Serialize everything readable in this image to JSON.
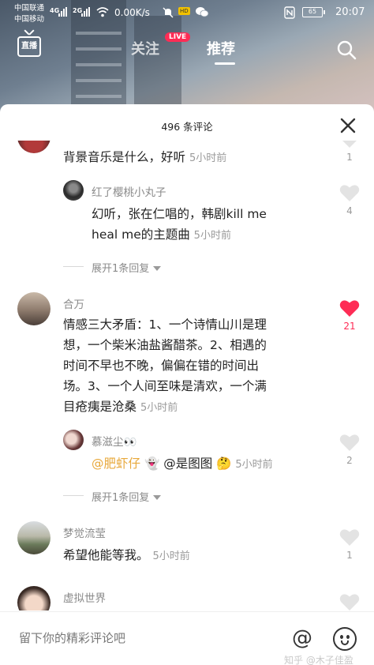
{
  "status_bar": {
    "carrier1": "中国联通",
    "carrier2": "中国移动",
    "net1": "4G",
    "net2": "2G",
    "speed": "0.00K/s",
    "hd": "HD",
    "battery": "65",
    "time": "20:07"
  },
  "top_nav": {
    "live_icon_label": "直播",
    "follow_tab": "关注",
    "live_badge": "LIVE",
    "recommend_tab": "推荐"
  },
  "sheet": {
    "title": "496 条评论"
  },
  "comments": [
    {
      "text": "背景音乐是什么，好听",
      "time": "5小时前",
      "likes": "1"
    },
    {
      "username": "红了樱桃小丸子",
      "text_line1": "幻听，张在仁唱的，韩剧kill me",
      "text_line2": "heal me的主题曲",
      "time": "5小时前",
      "likes": "4"
    },
    {
      "expand_label": "展开1条回复"
    },
    {
      "username": "合万",
      "lines": [
        "情感三大矛盾：1、一个诗情山川是理",
        "想，一个柴米油盐酱醋茶。2、相遇的",
        "时间不早也不晚，偏偏在错的时间出",
        "场。3、一个人间至味是清欢，一个满",
        "目疮痍是沧桑"
      ],
      "time": "5小时前",
      "likes": "21"
    },
    {
      "username": "慕滋尘👀",
      "mention": "@肥虾仔",
      "emoji1": "👻",
      "text": "@是图图",
      "emoji2": "🤔",
      "time": "5小时前",
      "likes": "2"
    },
    {
      "expand_label": "展开1条回复"
    },
    {
      "username": "梦觉流莹",
      "text": "希望他能等我。",
      "time": "5小时前",
      "likes": "1"
    },
    {
      "username": "虚拟世界"
    }
  ],
  "input": {
    "placeholder": "留下你的精彩评论吧",
    "at_symbol": "@",
    "watermark": "知乎 @木子佳盈"
  },
  "colors": {
    "like_active": "#fe2c55",
    "like_inactive": "#e3e3e3",
    "mention": "#e8a83a"
  }
}
